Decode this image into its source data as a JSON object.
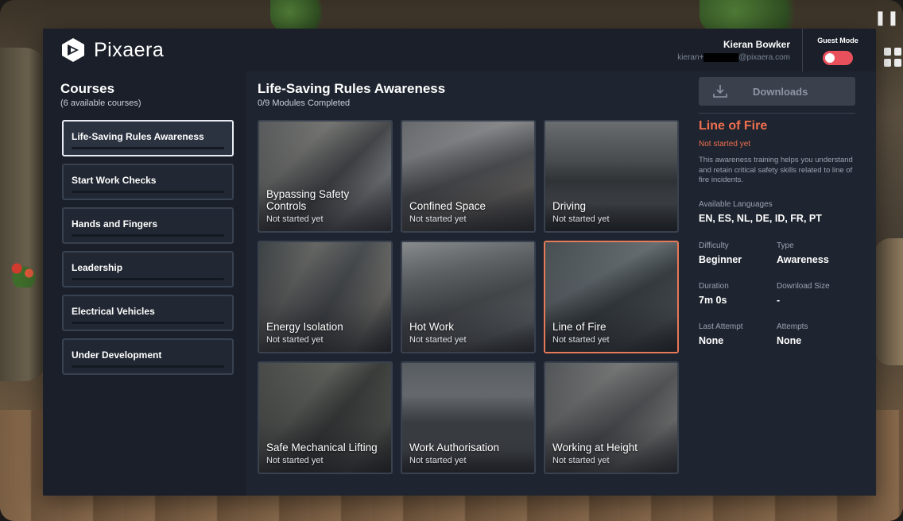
{
  "header": {
    "brand": "Pixaera",
    "user_name": "Kieran Bowker",
    "user_email_prefix": "kieran+",
    "user_email_suffix": "@pixaera.com",
    "guest_mode_label": "Guest Mode",
    "guest_mode_on": false
  },
  "sidebar": {
    "title": "Courses",
    "subtitle": "(6 available courses)",
    "courses": [
      {
        "label": "Life-Saving Rules Awareness",
        "active": true
      },
      {
        "label": "Start Work Checks",
        "active": false
      },
      {
        "label": "Hands and Fingers",
        "active": false
      },
      {
        "label": "Leadership",
        "active": false
      },
      {
        "label": "Electrical Vehicles",
        "active": false
      },
      {
        "label": "Under Development",
        "active": false
      }
    ]
  },
  "content": {
    "title": "Life-Saving Rules Awareness",
    "progress": "0/9 Modules Completed",
    "modules": [
      {
        "title": "Bypassing Safety Controls",
        "status": "Not started yet"
      },
      {
        "title": "Confined Space",
        "status": "Not started yet"
      },
      {
        "title": "Driving",
        "status": "Not started yet"
      },
      {
        "title": "Energy Isolation",
        "status": "Not started yet"
      },
      {
        "title": "Hot Work",
        "status": "Not started yet"
      },
      {
        "title": "Line of Fire",
        "status": "Not started yet"
      },
      {
        "title": "Safe Mechanical Lifting",
        "status": "Not started yet"
      },
      {
        "title": "Work Authorisation",
        "status": "Not started yet"
      },
      {
        "title": "Working at Height",
        "status": "Not started yet"
      }
    ]
  },
  "detail": {
    "downloads_label": "Downloads",
    "title": "Line of Fire",
    "status": "Not started yet",
    "description": "This awareness training helps you understand and retain critical safety skills related to line of fire incidents.",
    "languages_label": "Available Languages",
    "languages_value": "EN, ES, NL, DE, ID, FR, PT",
    "difficulty_label": "Difficulty",
    "difficulty_value": "Beginner",
    "type_label": "Type",
    "type_value": "Awareness",
    "duration_label": "Duration",
    "duration_value": "7m 0s",
    "download_size_label": "Download Size",
    "download_size_value": "-",
    "last_attempt_label": "Last Attempt",
    "last_attempt_value": "None",
    "attempts_label": "Attempts",
    "attempts_value": "None"
  },
  "colors": {
    "accent": "#ef6f4f",
    "toggle_off": "#e8505b",
    "panel": "#1f2530"
  },
  "icons": {
    "pause": "pause-icon",
    "apps": "apps-grid-icon",
    "download": "download-icon"
  }
}
